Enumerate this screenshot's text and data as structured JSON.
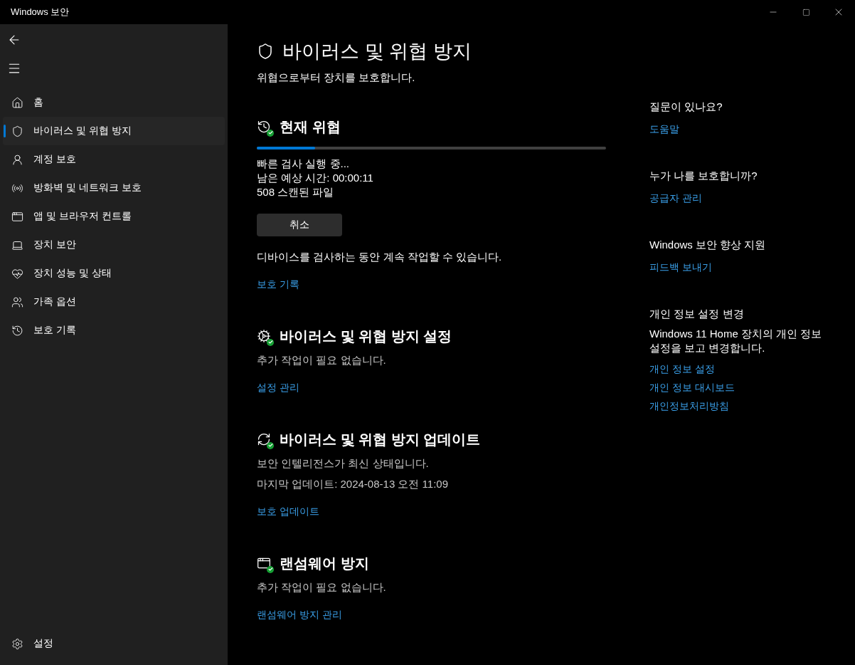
{
  "window": {
    "title": "Windows 보안"
  },
  "sidebar": {
    "items": [
      {
        "label": "홈",
        "selected": false
      },
      {
        "label": "바이러스 및 위협 방지",
        "selected": true
      },
      {
        "label": "계정 보호",
        "selected": false
      },
      {
        "label": "방화벽 및 네트워크 보호",
        "selected": false
      },
      {
        "label": "앱 및 브라우저 컨트롤",
        "selected": false
      },
      {
        "label": "장치 보안",
        "selected": false
      },
      {
        "label": "장치 성능 및 상태",
        "selected": false
      },
      {
        "label": "가족 옵션",
        "selected": false
      },
      {
        "label": "보호 기록",
        "selected": false
      }
    ],
    "footer": {
      "label": "설정"
    }
  },
  "page": {
    "title": "바이러스 및 위협 방지",
    "subtitle": "위협으로부터 장치를 보호합니다."
  },
  "sections": [
    {
      "kind": "scan",
      "title": "현재 위협",
      "progress": {
        "level": 0.167
      },
      "lines": [
        "빠른 검사 실행 중...",
        "남은 예상 시간: 00:00:11",
        "508 스캔된 파일"
      ],
      "button": "취소",
      "note": "디바이스를 검사하는 동안 계속 작업할 수 있습니다.",
      "link": "보호 기록"
    },
    {
      "kind": "status",
      "title": "바이러스 및 위협 방지 설정",
      "lines": [
        "추가 작업이 필요 없습니다."
      ],
      "link": "설정 관리"
    },
    {
      "kind": "status",
      "title": "바이러스 및 위협 방지 업데이트",
      "lines": [
        "보안 인텔리전스가 최신 상태입니다.",
        "마지막 업데이트: 2024-08-13 오전 11:09"
      ],
      "link": "보호 업데이트"
    },
    {
      "kind": "status",
      "title": "랜섬웨어 방지",
      "lines": [
        "추가 작업이 필요 없습니다."
      ],
      "link": "랜섬웨어 방지 관리"
    }
  ],
  "aside": [
    {
      "heading": "질문이 있나요?",
      "links": [
        "도움말"
      ]
    },
    {
      "heading": "누가 나를 보호합니까?",
      "links": [
        "공급자 관리"
      ]
    },
    {
      "heading": "Windows 보안 향상 지원",
      "links": [
        "피드백 보내기"
      ]
    },
    {
      "heading": "개인 정보 설정 변경",
      "text": "Windows 11 Home 장치의 개인 정보 설정을 보고 변경합니다.",
      "links": [
        "개인 정보 설정",
        "개인 정보 대시보드",
        "개인정보처리방침"
      ]
    }
  ]
}
